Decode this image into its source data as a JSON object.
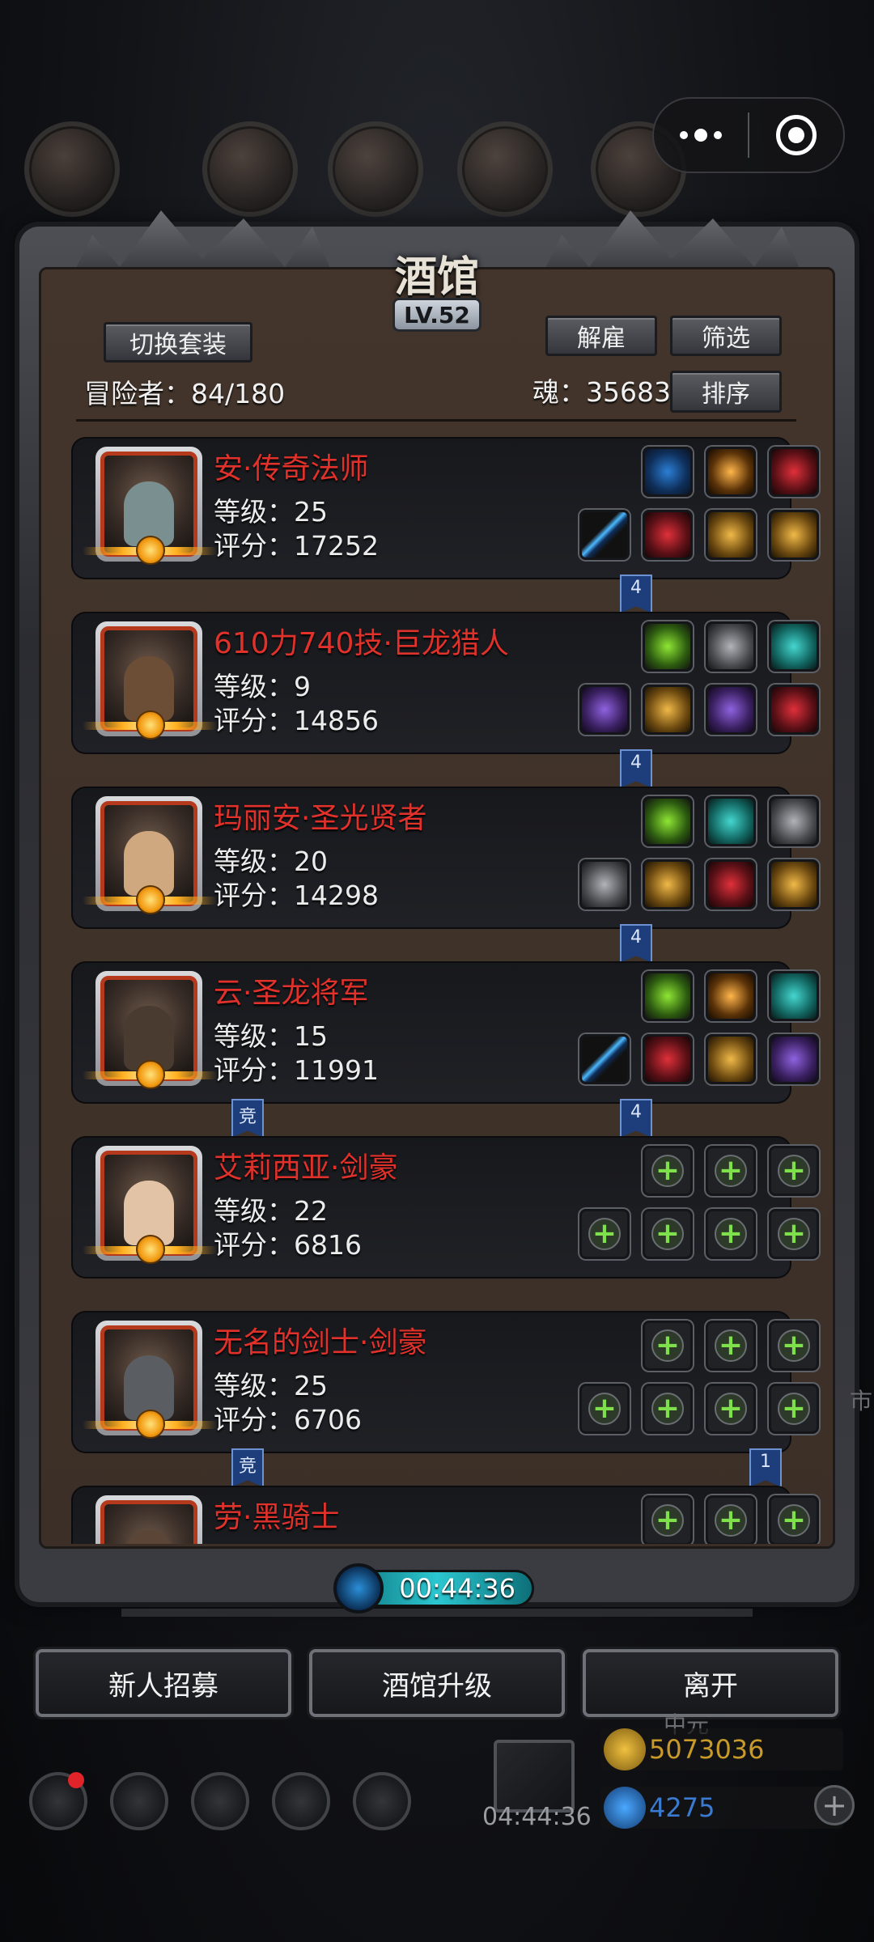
{
  "window": {
    "title": "酒馆",
    "level": "LV.52"
  },
  "header": {
    "switch_outfit": "切换套装",
    "dismiss": "解雇",
    "filter": "筛选",
    "sort": "排序",
    "adventurers_label": "冒险者：84/180",
    "soul_label": "魂：35683"
  },
  "heroes": [
    {
      "name": "安·传奇法师",
      "level": "等级：25",
      "score": "评分：17252"
    },
    {
      "name": "610力740技·巨龙猎人",
      "level": "等级：9",
      "score": "评分：14856"
    },
    {
      "name": "玛丽安·圣光贤者",
      "level": "等级：20",
      "score": "评分：14298"
    },
    {
      "name": "云·圣龙将军",
      "level": "等级：15",
      "score": "评分：11991"
    },
    {
      "name": "艾莉西亚·剑豪",
      "level": "等级：22",
      "score": "评分：6816"
    },
    {
      "name": "无名的剑士·剑豪",
      "level": "等级：25",
      "score": "评分：6706"
    },
    {
      "name": "劳·黑骑士",
      "level": "",
      "score": ""
    }
  ],
  "tags": {
    "four": "4",
    "one": "1",
    "compete": "竞"
  },
  "timer": "00:44:36",
  "buttons": {
    "recruit": "新人招募",
    "upgrade": "酒馆升级",
    "leave": "离开"
  },
  "background": {
    "gift_timer": "04:44:36",
    "gold": "5073036",
    "gems": "4275",
    "peek_1": "中元",
    "peek_2": "市"
  }
}
